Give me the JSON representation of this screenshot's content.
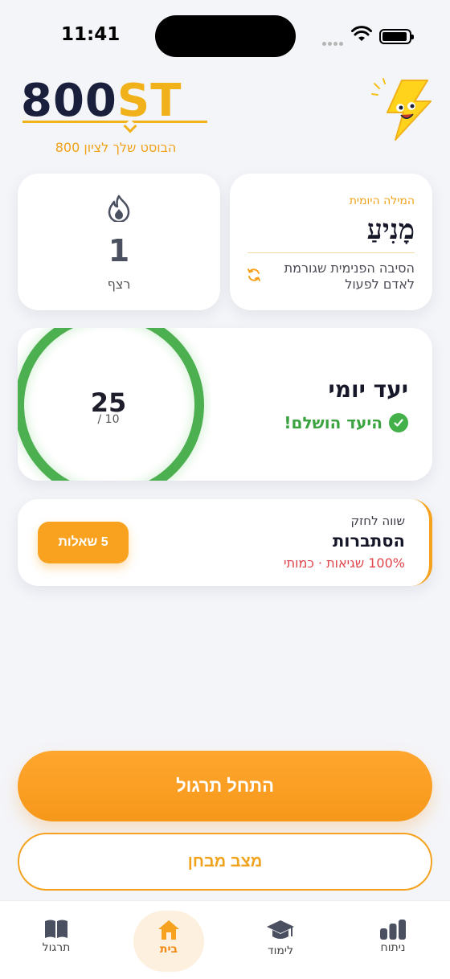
{
  "status_bar": {
    "time": "11:41"
  },
  "header": {
    "logo": {
      "part1": "800",
      "part2": "ST"
    },
    "tagline": "הבוסט שלך לציון 800",
    "mascot_icon": "lightning-mascot-icon"
  },
  "streak": {
    "icon": "flame-icon",
    "count": "1",
    "label": "רצף"
  },
  "daily_word": {
    "heading": "המילה היומית",
    "word": "מָנִיעַ",
    "definition": "הסיבה הפנימית שגורמת לאדם לפעול",
    "refresh_icon": "refresh-icon"
  },
  "daily_goal": {
    "title": "יעד יומי",
    "done": "25",
    "target": "/ 10",
    "status": "היעד הושלם!",
    "progress": 1.0,
    "color": "#4caf50"
  },
  "weak_topic": {
    "heading": "שווה לחזק",
    "topic": "הסתברות",
    "stats": "100% שגיאות · כמותי",
    "button_label": "5 שאלות"
  },
  "actions": {
    "start_label": "התחל תרגול",
    "exam_label": "מצב מבחן"
  },
  "tabs": [
    {
      "label": "תרגול",
      "icon": "book-icon"
    },
    {
      "label": "בית",
      "icon": "home-icon",
      "active": true
    },
    {
      "label": "לימוד",
      "icon": "graduation-cap-icon"
    },
    {
      "label": "ניתוח",
      "icon": "bar-chart-icon"
    }
  ],
  "colors": {
    "accent": "#f8a21f",
    "success": "#43b04a",
    "danger": "#e0434a",
    "navy": "#1a1f3c"
  }
}
